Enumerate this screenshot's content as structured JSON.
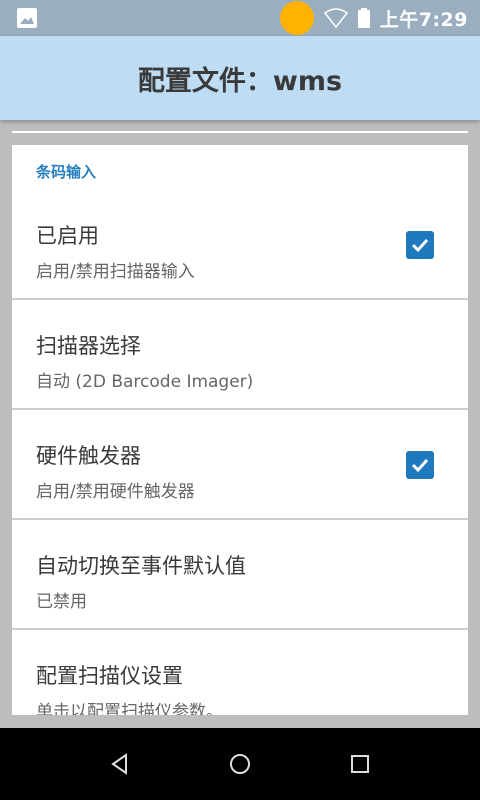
{
  "status_bar": {
    "time": "上午7:29",
    "icons": [
      "image-icon",
      "wifi-icon",
      "battery-icon"
    ]
  },
  "app_bar": {
    "title": "配置文件：wms"
  },
  "section": {
    "category": "条码输入",
    "items": [
      {
        "title": "已启用",
        "summary": "启用/禁用扫描器输入",
        "checked": true
      },
      {
        "title": "扫描器选择",
        "summary": "自动 (2D Barcode Imager)",
        "checked": null
      },
      {
        "title": "硬件触发器",
        "summary": "启用/禁用硬件触发器",
        "checked": true
      },
      {
        "title": "自动切换至事件默认值",
        "summary": "已禁用",
        "checked": null
      },
      {
        "title": "配置扫描仪设置",
        "summary": "单击以配置扫描仪参数。",
        "checked": null
      }
    ]
  },
  "nav_bar": {
    "buttons": [
      "back-icon",
      "home-icon",
      "recents-icon"
    ]
  },
  "colors": {
    "status_bar": "#9aaec0",
    "app_bar": "#bedcf3",
    "accent": "#2a7fbf",
    "checkbox": "#1f79be"
  }
}
